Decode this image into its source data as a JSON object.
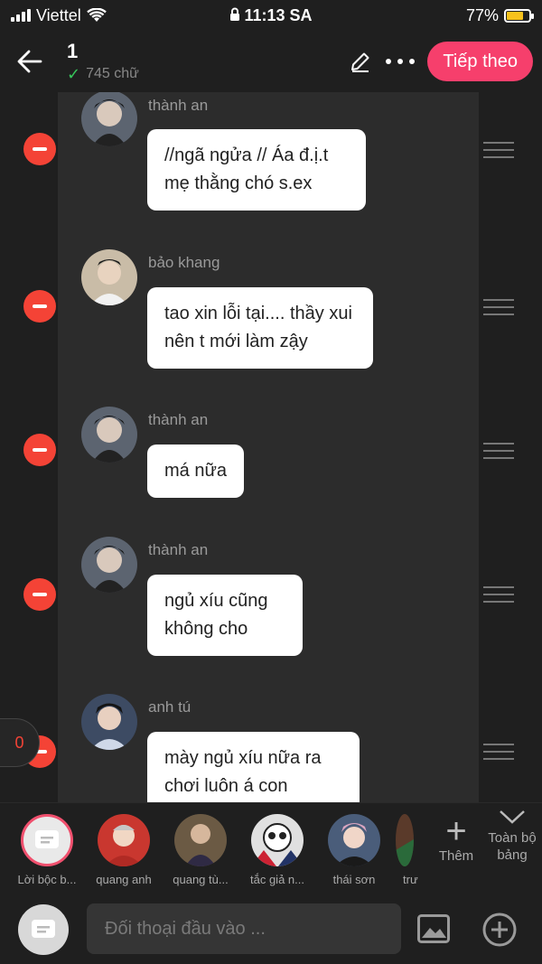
{
  "status_bar": {
    "carrier": "Viettel",
    "time": "11:13 SA",
    "battery": "77%",
    "battery_level": 0.77
  },
  "header": {
    "title": "1",
    "word_count": "745 chữ",
    "next_label": "Tiếp theo"
  },
  "messages": [
    {
      "name": "thành an",
      "text": "//ngã ngửa // Áa đ.ị.t mẹ thằng chó s.ex",
      "avatar_color": "#5c6470"
    },
    {
      "name": "bảo khang",
      "text": "tao xin lỗi tại.... thầy xui nên t mới làm zậy",
      "avatar_color": "#c9bca7"
    },
    {
      "name": "thành an",
      "text": "má nữa",
      "avatar_color": "#5c6470"
    },
    {
      "name": "thành an",
      "text": "ngủ xíu cũng không cho",
      "avatar_color": "#5c6470"
    },
    {
      "name": "anh tú",
      "text": "mày ngủ xíu nữa ra chơi luôn á con",
      "avatar_color": "#3d4b63"
    }
  ],
  "unread_count": "0",
  "characters": [
    {
      "label": "Lời bộc b...",
      "color": "#e9e9e9"
    },
    {
      "label": "quang anh",
      "color": "#c9372f"
    },
    {
      "label": "quang tù...",
      "color": "#6b5a44"
    },
    {
      "label": "tắc giả n...",
      "color": "#e0e0e0"
    },
    {
      "label": "thái sơn",
      "color": "#4a5d7a"
    },
    {
      "label": "trư",
      "color": "#5a3a2a"
    }
  ],
  "add_label": "Thêm",
  "all_board_label": "Toàn bộ bảng",
  "input": {
    "placeholder": "Đối thoại đầu vào ..."
  }
}
